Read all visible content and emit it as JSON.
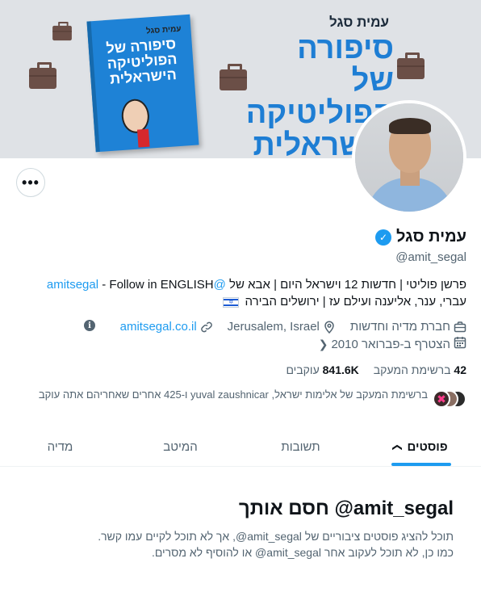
{
  "banner": {
    "author": "עמית סגל",
    "title_lines": [
      "סיפורה של",
      "הפוליטיקה",
      "הישראלית"
    ],
    "book": {
      "author": "עמית סגל",
      "title": "סיפורה של הפוליטיקה הישראלית"
    }
  },
  "profile": {
    "display_name": "עמית סגל",
    "verified_symbol": "✓",
    "handle": "@amit_segal",
    "more_label": "•••",
    "bio": {
      "line1_text": "פרשן פוליטי | חדשות 12 וישראל היום | אבא של",
      "line1_link": "@amitsegal",
      "line1_suffix": "- Follow in ENGLISH",
      "line2_text": "עברי, ענר, אליענה ועילם עז | ירושלים הבירה"
    },
    "meta": {
      "category": "חברת מדיה וחדשות",
      "location": "Jerusalem, Israel",
      "website": "amitsegal.co.il",
      "joined": "הצטרף ב-פברואר 2010",
      "info_symbol": "i"
    },
    "stats": {
      "following_count": "42",
      "following_label": "ברשימת המעקב",
      "followers_count": "841.6K",
      "followers_label": "עוקבים"
    },
    "followers_you_know": "ברשימת המעקב של אלימות ישראל, yuval zaushnicar ו-425 אחרים שאחריהם אתה עוקב"
  },
  "tabs": [
    {
      "label": "פוסטים",
      "active": true,
      "chevron": "❯"
    },
    {
      "label": "תשובות",
      "active": false
    },
    {
      "label": "המיטב",
      "active": false
    },
    {
      "label": "מדיה",
      "active": false
    }
  ],
  "blocked": {
    "title": "amit_segal@ חסם אותך",
    "line1": "תוכל להציג פוסטים ציבוריים של amit_segal@, אך לא תוכל לקיים עמו קשר.",
    "line2": "כמו כן, לא תוכל לעקוב אחר amit_segal@ או להוסיף לא מסרים."
  },
  "colors": {
    "accent": "#1d9bf0",
    "text": "#0f1419",
    "secondary_text": "#536471"
  }
}
